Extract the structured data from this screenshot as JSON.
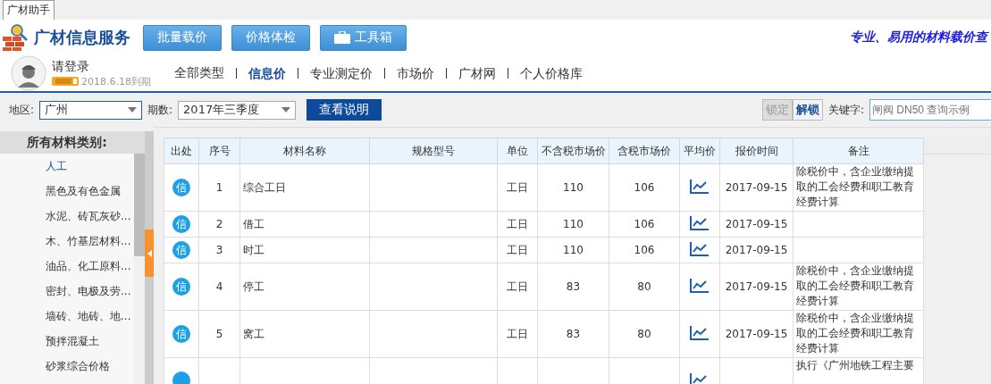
{
  "app_tab": {
    "label": "广材助手",
    "selected": true
  },
  "header": {
    "title": "广材信息服务",
    "buttons": [
      {
        "label": "批量载价",
        "kind": "plain"
      },
      {
        "label": "价格体检",
        "kind": "plain"
      },
      {
        "label": "工具箱",
        "kind": "toolbox"
      }
    ],
    "tagline": "专业、易用的材料载价查"
  },
  "user": {
    "login": "请登录",
    "expiry": "2018.6.18到期"
  },
  "nav": [
    {
      "label": "全部类型",
      "selected": false
    },
    {
      "label": "信息价",
      "selected": true
    },
    {
      "label": "专业测定价",
      "selected": false
    },
    {
      "label": "市场价",
      "selected": false
    },
    {
      "label": "广材网",
      "selected": false
    },
    {
      "label": "个人价格库",
      "selected": false
    }
  ],
  "filters": {
    "region_label": "地区:",
    "region": "广州",
    "period_label": "期数:",
    "period": "2017年三季度",
    "explain_button": "查看说明",
    "lock_buttons": [
      {
        "label": "锁定",
        "disabled": true
      },
      {
        "label": "解锁",
        "disabled": false
      }
    ],
    "keyword_label": "关键字:",
    "keyword_placeholder": "闸阀 DN50 查询示例"
  },
  "sidebar": {
    "title": "所有材料类别:",
    "items": [
      {
        "label": "人工",
        "selected": true
      },
      {
        "label": "黑色及有色金属",
        "selected": false
      },
      {
        "label": "水泥、砖瓦灰砂...",
        "selected": false
      },
      {
        "label": "木、竹基层材料...",
        "selected": false
      },
      {
        "label": "油品、化工原料...",
        "selected": false
      },
      {
        "label": "密封、电极及劳...",
        "selected": false
      },
      {
        "label": "墙砖、地砖、地...",
        "selected": false
      },
      {
        "label": "预拌混凝土",
        "selected": false
      },
      {
        "label": "砂浆综合价格",
        "selected": false
      }
    ]
  },
  "table": {
    "columns": [
      "出处",
      "序号",
      "材料名称",
      "规格型号",
      "单位",
      "不含税市场价",
      "含税市场价",
      "平均价",
      "报价时间",
      "备注"
    ],
    "rows": [
      {
        "source": "信",
        "no": "1",
        "name": "综合工日",
        "unit": "工日",
        "price_ex_tax": "110",
        "price_tax": "106",
        "date": "2017-09-15",
        "remark": "除税价中，含企业缴纳提取的工会经费和职工教育经费计算"
      },
      {
        "source": "信",
        "no": "2",
        "name": "借工",
        "unit": "工日",
        "price_ex_tax": "110",
        "price_tax": "106",
        "date": "2017-09-15"
      },
      {
        "source": "信",
        "no": "3",
        "name": "时工",
        "unit": "工日",
        "price_ex_tax": "110",
        "price_tax": "106",
        "date": "2017-09-15"
      },
      {
        "source": "信",
        "no": "4",
        "name": "停工",
        "unit": "工日",
        "price_ex_tax": "83",
        "price_tax": "80",
        "date": "2017-09-15",
        "remark": "除税价中，含企业缴纳提取的工会经费和职工教育经费计算"
      },
      {
        "source": "信",
        "no": "5",
        "name": "窝工",
        "unit": "工日",
        "price_ex_tax": "83",
        "price_tax": "80",
        "date": "2017-09-15",
        "remark": "除税价中，含企业缴纳提取的工会经费和职工教育经费计算"
      },
      {
        "remark": "执行《广州地铁工程主要"
      }
    ]
  }
}
